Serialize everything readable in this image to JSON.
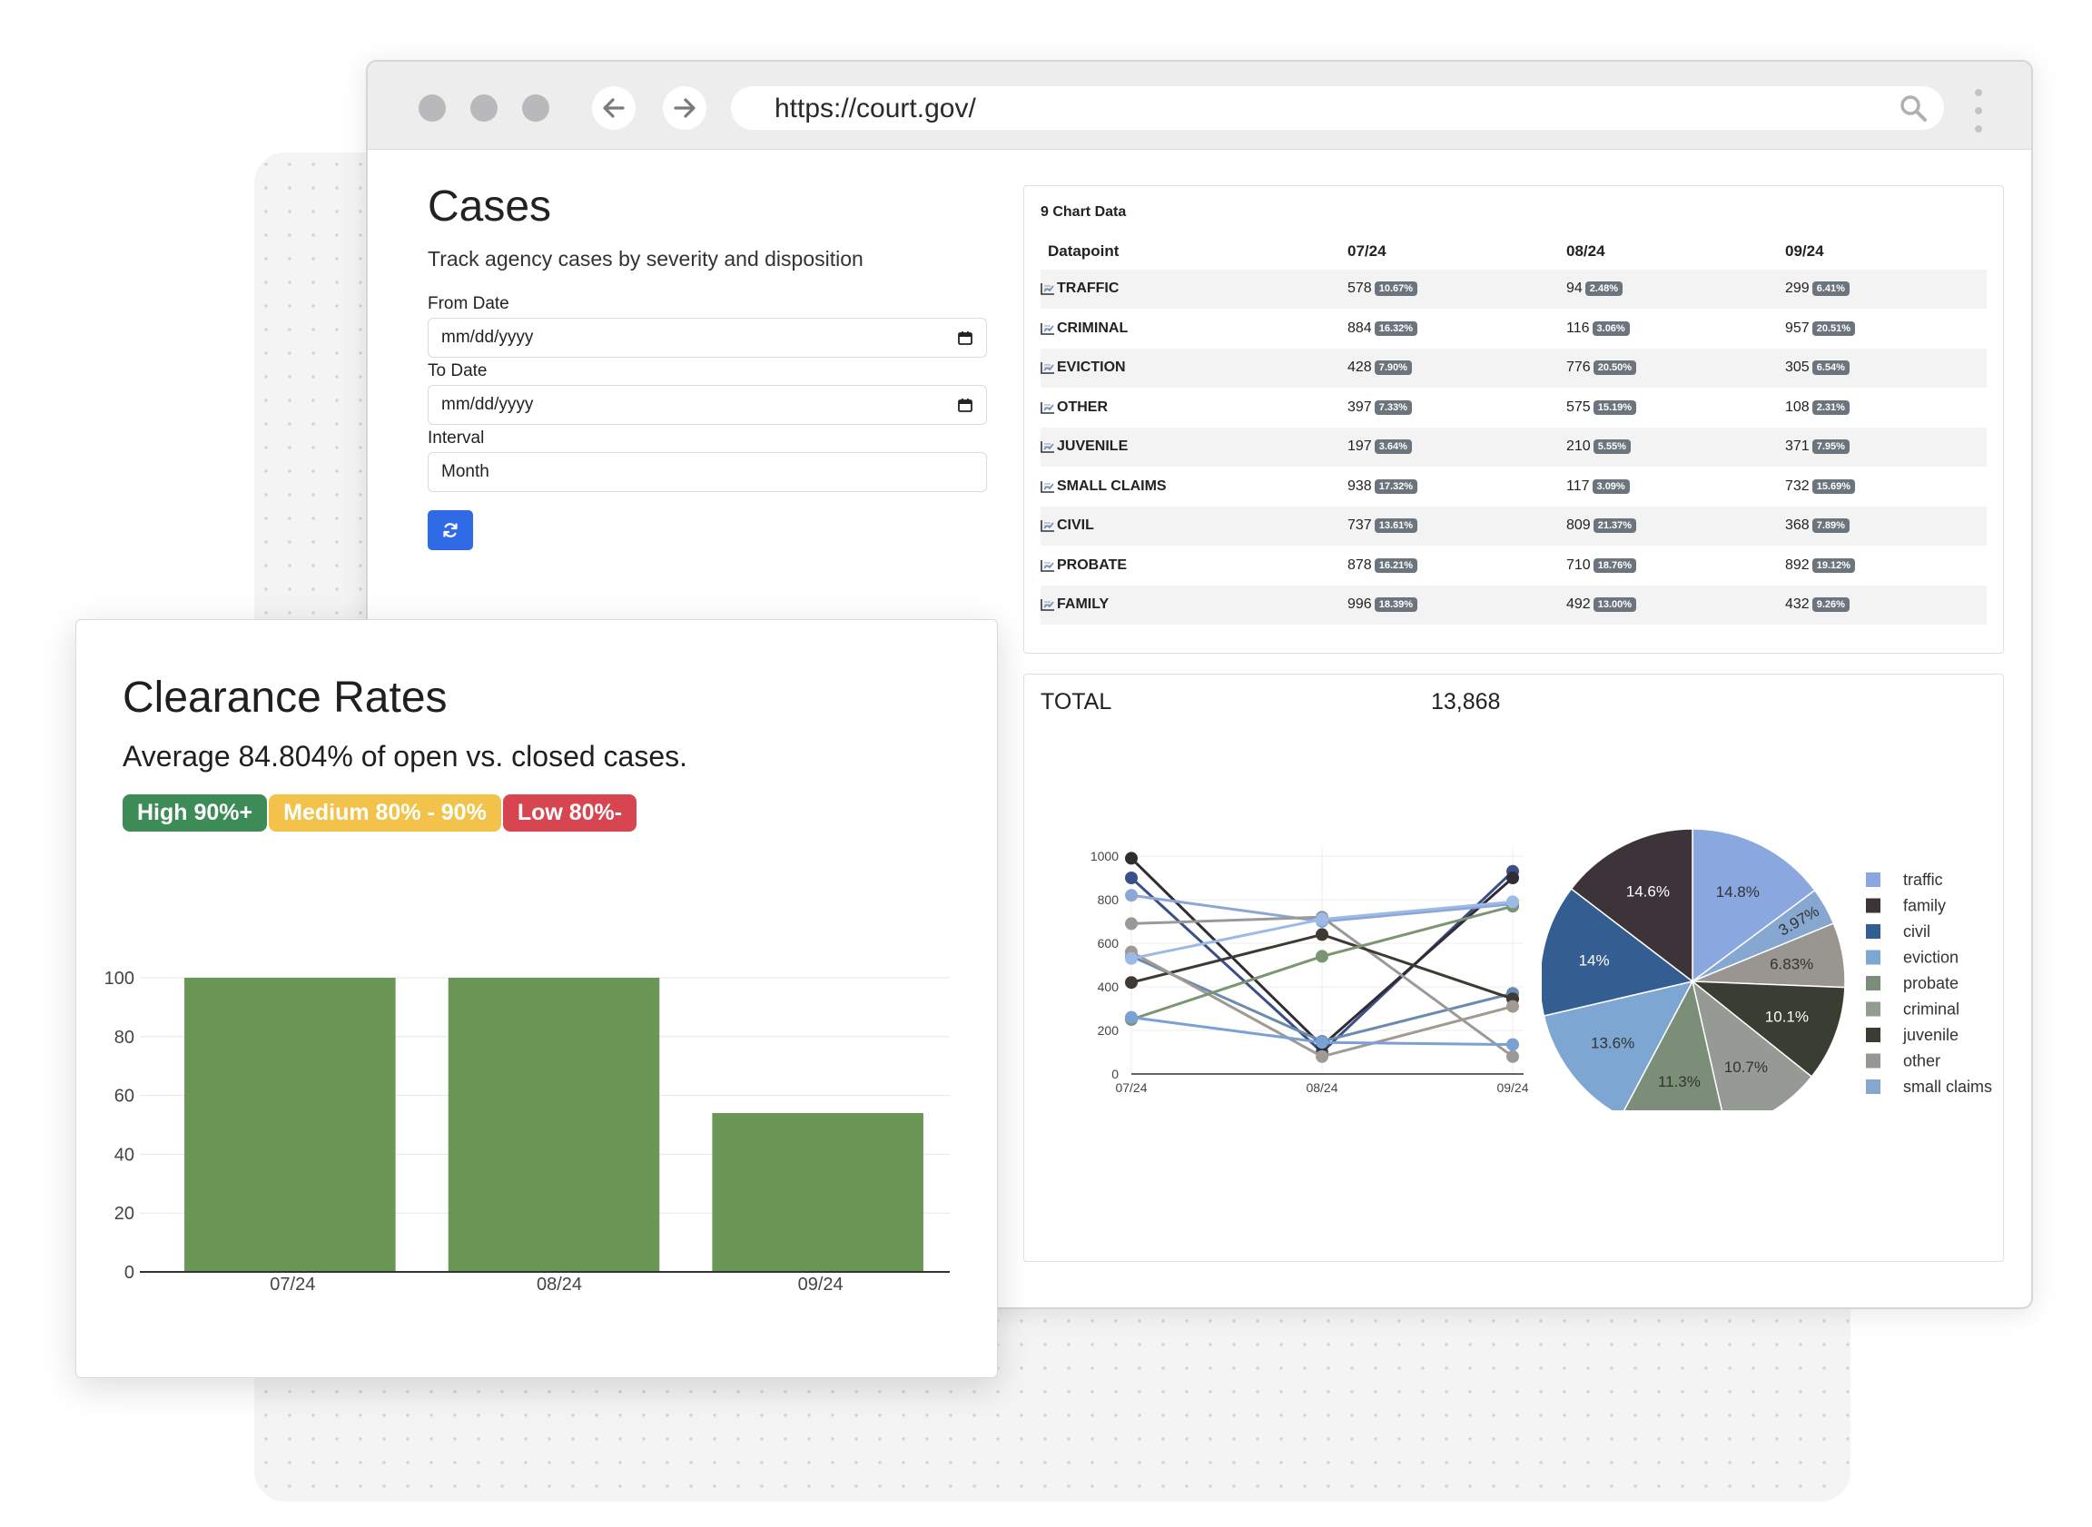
{
  "browser": {
    "url": "https://court.gov/",
    "back_icon": "arrow-left-icon",
    "forward_icon": "arrow-right-icon",
    "search_icon": "search-icon"
  },
  "filters": {
    "title": "Cases",
    "subtitle": "Track agency cases by severity and disposition",
    "from_label": "From Date",
    "from_placeholder": "mm/dd/yyyy",
    "to_label": "To Date",
    "to_placeholder": "mm/dd/yyyy",
    "interval_label": "Interval",
    "interval_value": "Month",
    "refresh_icon": "refresh-icon"
  },
  "table": {
    "title": "9 Chart Data",
    "headers": [
      "Datapoint",
      "07/24",
      "08/24",
      "09/24"
    ],
    "rows": [
      {
        "name": "TRAFFIC",
        "cells": [
          {
            "v": "578",
            "p": "10.67%"
          },
          {
            "v": "94",
            "p": "2.48%"
          },
          {
            "v": "299",
            "p": "6.41%"
          }
        ]
      },
      {
        "name": "CRIMINAL",
        "cells": [
          {
            "v": "884",
            "p": "16.32%"
          },
          {
            "v": "116",
            "p": "3.06%"
          },
          {
            "v": "957",
            "p": "20.51%"
          }
        ]
      },
      {
        "name": "EVICTION",
        "cells": [
          {
            "v": "428",
            "p": "7.90%"
          },
          {
            "v": "776",
            "p": "20.50%"
          },
          {
            "v": "305",
            "p": "6.54%"
          }
        ]
      },
      {
        "name": "OTHER",
        "cells": [
          {
            "v": "397",
            "p": "7.33%"
          },
          {
            "v": "575",
            "p": "15.19%"
          },
          {
            "v": "108",
            "p": "2.31%"
          }
        ]
      },
      {
        "name": "JUVENILE",
        "cells": [
          {
            "v": "197",
            "p": "3.64%"
          },
          {
            "v": "210",
            "p": "5.55%"
          },
          {
            "v": "371",
            "p": "7.95%"
          }
        ]
      },
      {
        "name": "SMALL CLAIMS",
        "cells": [
          {
            "v": "938",
            "p": "17.32%"
          },
          {
            "v": "117",
            "p": "3.09%"
          },
          {
            "v": "732",
            "p": "15.69%"
          }
        ]
      },
      {
        "name": "CIVIL",
        "cells": [
          {
            "v": "737",
            "p": "13.61%"
          },
          {
            "v": "809",
            "p": "21.37%"
          },
          {
            "v": "368",
            "p": "7.89%"
          }
        ]
      },
      {
        "name": "PROBATE",
        "cells": [
          {
            "v": "878",
            "p": "16.21%"
          },
          {
            "v": "710",
            "p": "18.76%"
          },
          {
            "v": "892",
            "p": "19.12%"
          }
        ]
      },
      {
        "name": "FAMILY",
        "cells": [
          {
            "v": "996",
            "p": "18.39%"
          },
          {
            "v": "492",
            "p": "13.00%"
          },
          {
            "v": "432",
            "p": "9.26%"
          }
        ]
      }
    ]
  },
  "totals": {
    "label": "TOTAL",
    "value": "13,868"
  },
  "clearance": {
    "title": "Clearance Rates",
    "subtitle": "Average 84.804% of open vs. closed cases.",
    "badges": [
      {
        "label": "High 90%+",
        "color": "#3d8b57"
      },
      {
        "label": "Medium 80% - 90%",
        "color": "#f2c24a"
      },
      {
        "label": "Low 80%-",
        "color": "#d64550"
      }
    ]
  },
  "chart_data": [
    {
      "type": "line",
      "x": [
        "07/24",
        "08/24",
        "09/24"
      ],
      "ylim": [
        0,
        1000
      ],
      "yticks": [
        0,
        200,
        400,
        600,
        800,
        1000
      ],
      "grid": true,
      "series": [
        {
          "color": "#3a4f8a",
          "values": [
            900,
            100,
            930
          ]
        },
        {
          "color": "#312c33",
          "values": [
            990,
            130,
            900
          ]
        },
        {
          "color": "#6b8ab0",
          "values": [
            540,
            150,
            370
          ]
        },
        {
          "color": "#8ba7d6",
          "values": [
            820,
            700,
            780
          ]
        },
        {
          "color": "#999a97",
          "values": [
            690,
            720,
            80
          ]
        },
        {
          "color": "#3e3a33",
          "values": [
            420,
            640,
            345
          ]
        },
        {
          "color": "#a09a93",
          "values": [
            560,
            80,
            310
          ]
        },
        {
          "color": "#7b9573",
          "values": [
            250,
            540,
            770
          ]
        },
        {
          "color": "#7aa0d4",
          "values": [
            260,
            145,
            135
          ]
        },
        {
          "color": "#9db9e6",
          "values": [
            530,
            710,
            790
          ]
        }
      ]
    },
    {
      "type": "pie",
      "slices": [
        {
          "label": "traffic",
          "value": 14.8,
          "text": "14.8%",
          "color": "#8aa7e0",
          "text_color": "#333333"
        },
        {
          "label": "small claims",
          "value": 3.97,
          "text": "3.97%",
          "color": "#85a7d0",
          "text_color": "#333333"
        },
        {
          "label": "other",
          "value": 6.83,
          "text": "6.83%",
          "color": "#999590",
          "text_color": "#333333"
        },
        {
          "label": "juvenile",
          "value": 10.1,
          "text": "10.1%",
          "color": "#3a3d32",
          "text_color": "#ffffff"
        },
        {
          "label": "criminal",
          "value": 10.7,
          "text": "10.7%",
          "color": "#969a94",
          "text_color": "#333333"
        },
        {
          "label": "probate",
          "value": 11.3,
          "text": "11.3%",
          "color": "#7b8f78",
          "text_color": "#333333"
        },
        {
          "label": "eviction",
          "value": 13.6,
          "text": "13.6%",
          "color": "#7ea6d2",
          "text_color": "#333333"
        },
        {
          "label": "civil",
          "value": 14.0,
          "text": "14%",
          "color": "#345d92",
          "text_color": "#ffffff"
        },
        {
          "label": "family",
          "value": 14.6,
          "text": "14.6%",
          "color": "#3c3439",
          "text_color": "#ffffff"
        }
      ],
      "legend": [
        "traffic",
        "family",
        "civil",
        "eviction",
        "probate",
        "criminal",
        "juvenile",
        "other",
        "small claims"
      ],
      "legend_position": "right"
    },
    {
      "type": "bar",
      "categories": [
        "07/24",
        "08/24",
        "09/24"
      ],
      "values": [
        100,
        100,
        54
      ],
      "ylim": [
        0,
        100
      ],
      "yticks": [
        0,
        20,
        40,
        60,
        80,
        100
      ],
      "color": "#6a9656",
      "grid": true
    }
  ]
}
